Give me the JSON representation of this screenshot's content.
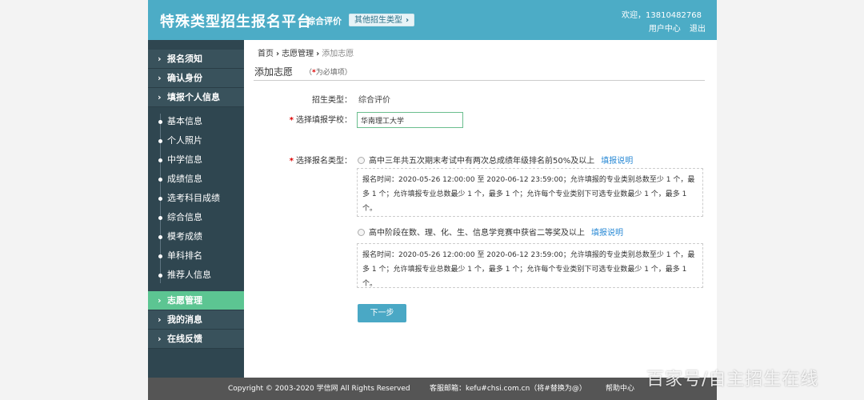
{
  "header": {
    "title": "特殊类型招生报名平台",
    "subtitle": "综合评价",
    "other_types_label": "其他招生类型",
    "welcome": "欢迎，13810482768",
    "user_center": "用户中心",
    "logout": "退出"
  },
  "sidebar": {
    "top_items": [
      {
        "label": "报名须知"
      },
      {
        "label": "确认身份"
      },
      {
        "label": "填报个人信息"
      }
    ],
    "sub_items": [
      {
        "label": "基本信息"
      },
      {
        "label": "个人照片"
      },
      {
        "label": "中学信息"
      },
      {
        "label": "成绩信息"
      },
      {
        "label": "选考科目成绩"
      },
      {
        "label": "综合信息"
      },
      {
        "label": "模考成绩"
      },
      {
        "label": "单科排名"
      },
      {
        "label": "推荐人信息"
      }
    ],
    "bottom_items": [
      {
        "label": "志愿管理",
        "active": true
      },
      {
        "label": "我的消息"
      },
      {
        "label": "在线反馈"
      }
    ]
  },
  "breadcrumb": {
    "home": "首页",
    "section": "志愿管理",
    "current": "添加志愿"
  },
  "page": {
    "title": "添加志愿",
    "required_note_open": "（",
    "required_note_star": "*",
    "required_note_text": "为必填项）"
  },
  "form": {
    "type_label": "招生类型：",
    "type_value": "综合评价",
    "school_label": "选择填报学校：",
    "school_value": "华南理工大学",
    "regtype_label": "选择报名类型：",
    "required_star": "*",
    "options": [
      {
        "label": "高中三年共五次期末考试中有两次总成绩年级排名前50%及以上",
        "help": "填报说明",
        "info": "报名时间：2020-05-26 12:00:00 至 2020-06-12 23:59:00；允许填报的专业类别总数至少 1 个，最多 1 个；允许填报专业总数最少 1 个，最多 1 个；允许每个专业类别下可选专业数最少 1 个，最多 1 个。"
      },
      {
        "label": "高中阶段在数、理、化、生、信息学竞赛中获省二等奖及以上",
        "help": "填报说明",
        "info": "报名时间：2020-05-26 12:00:00 至 2020-06-12 23:59:00；允许填报的专业类别总数至少 1 个，最多 1 个；允许填报专业总数最少 1 个，最多 1 个；允许每个专业类别下可选专业数最少 1 个，最多 1 个。"
      }
    ],
    "next_label": "下一步"
  },
  "footer": {
    "copyright": "Copyright © 2003-2020 学信网 All Rights Reserved",
    "email": "客服邮箱：kefu#chsi.com.cn（将#替换为@）",
    "help": "帮助中心"
  },
  "watermark": "百家号/自主招生在线",
  "colors": {
    "header_bg": "#4cacc6",
    "sidebar_bg": "#2f4650",
    "sidebar_active": "#5cc592",
    "link": "#2a8ad5",
    "button": "#4aa8c5"
  }
}
